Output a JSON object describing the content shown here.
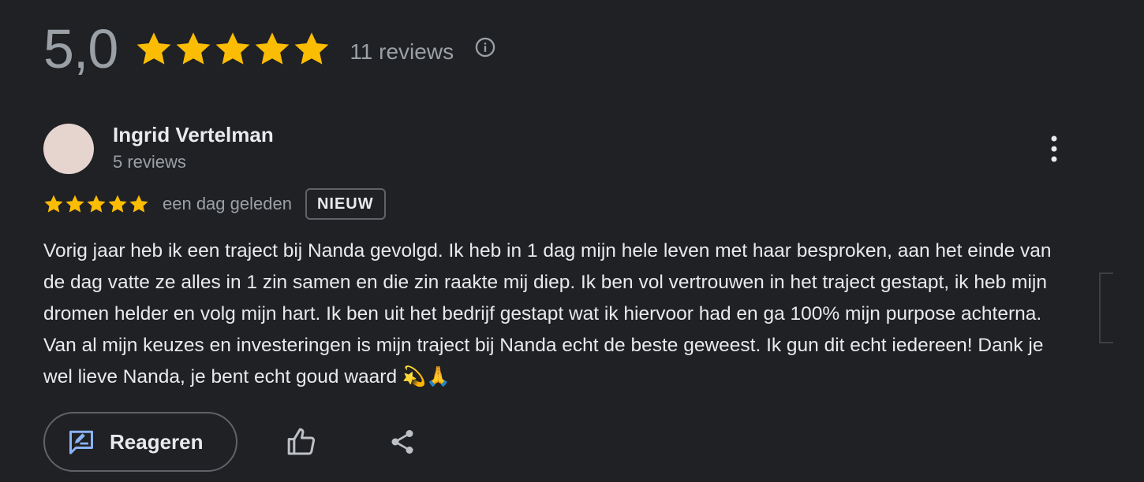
{
  "summary": {
    "rating": "5,0",
    "stars": 5,
    "review_count": "11 reviews",
    "info_icon": "info-icon"
  },
  "review": {
    "author_name": "Ingrid Vertelman",
    "author_reviews": "5 reviews",
    "stars": 5,
    "date": "een dag geleden",
    "badge": "NIEUW",
    "text": "Vorig jaar heb ik een traject bij Nanda gevolgd. Ik heb in 1 dag mijn hele leven met haar besproken, aan het einde van de dag vatte ze alles in 1 zin samen en die zin raakte mij diep. Ik ben vol vertrouwen in het traject gestapt, ik heb mijn dromen helder en volg mijn hart. Ik ben uit het bedrijf gestapt wat ik hiervoor had en ga 100% mijn purpose achterna. Van al mijn keuzes en investeringen is mijn traject bij Nanda echt de beste geweest. Ik gun dit echt iedereen! Dank je wel lieve Nanda, je bent echt goud waard 💫🙏",
    "more_icon": "more-vert-icon"
  },
  "actions": {
    "reply_label": "Reageren",
    "reply_icon": "reply-icon",
    "like_icon": "thumbs-up-icon",
    "share_icon": "share-icon"
  },
  "colors": {
    "background": "#202124",
    "star": "#fbbc04",
    "text_primary": "#e8eaed",
    "text_secondary": "#9aa0a6",
    "reply_icon": "#8ab4f8",
    "avatar": "#e6d5cf"
  }
}
